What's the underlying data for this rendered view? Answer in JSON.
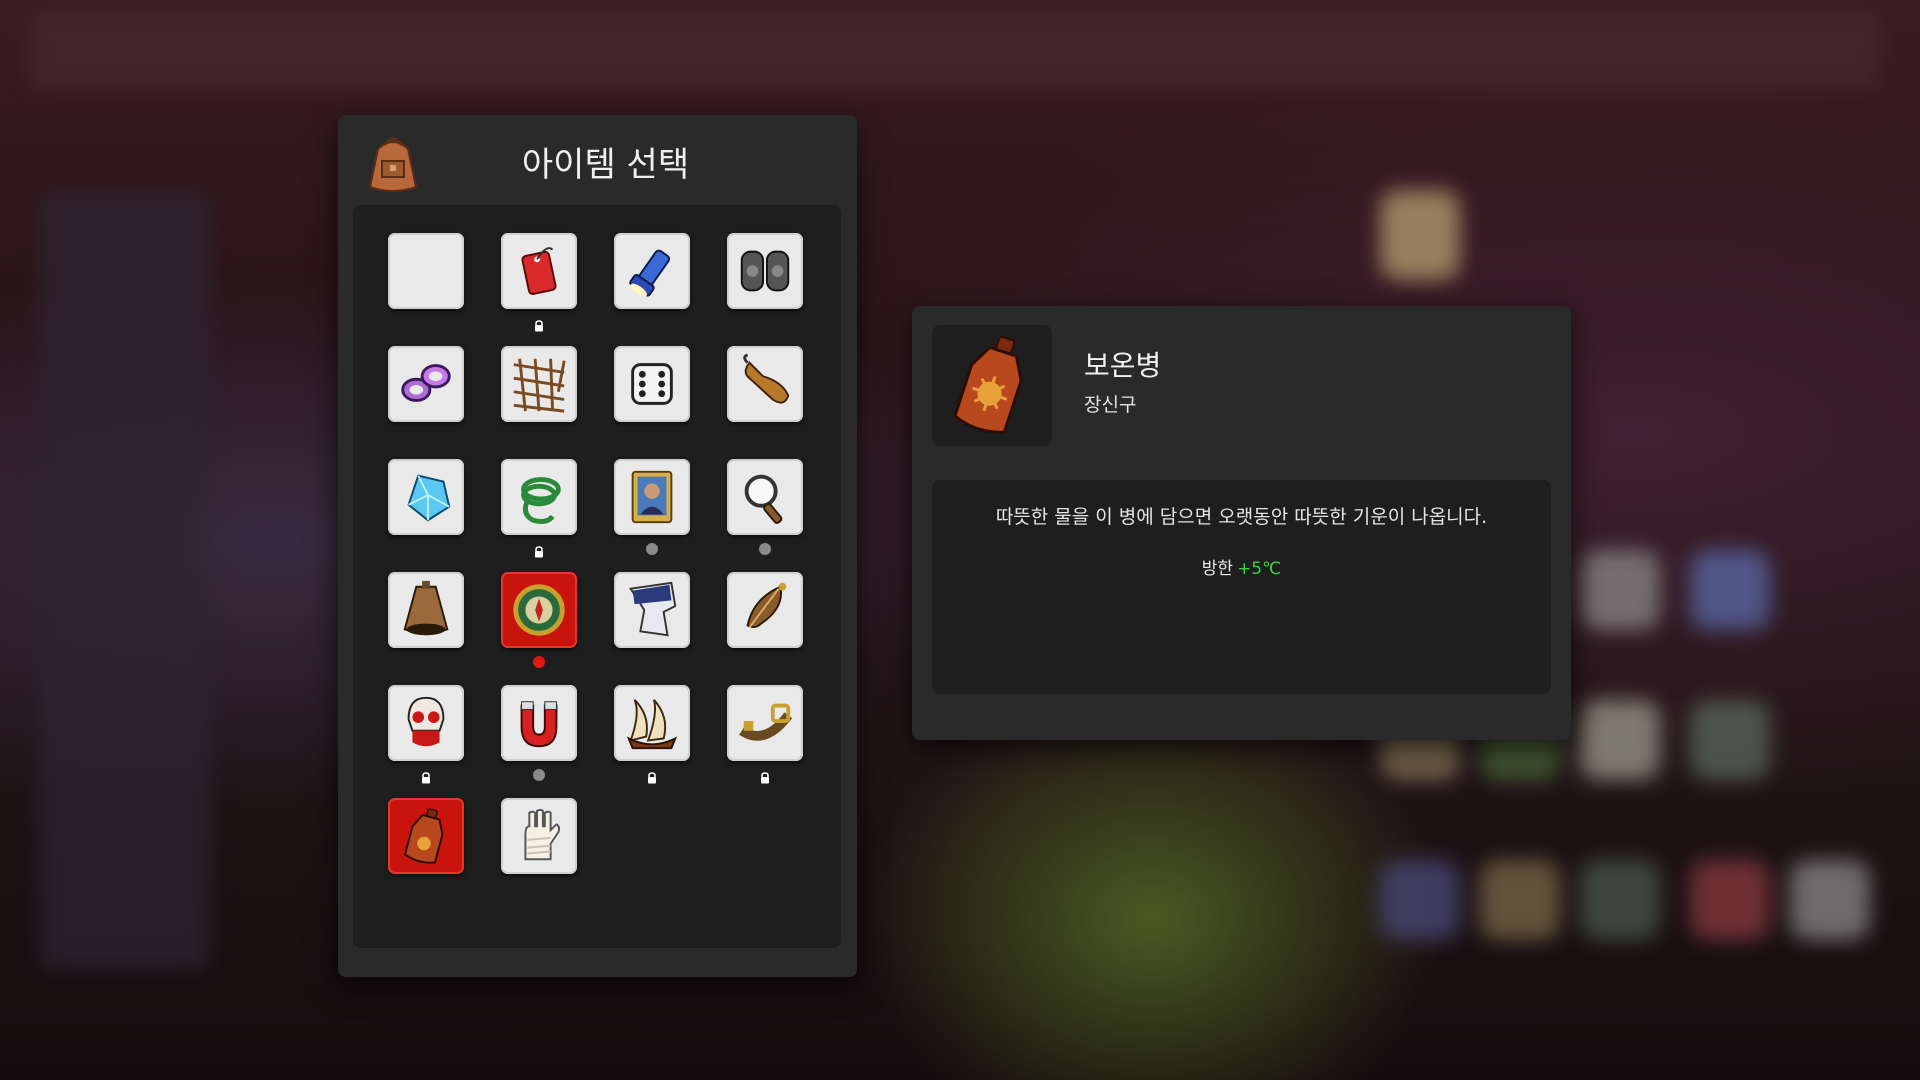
{
  "item_select": {
    "title": "아이템 선택",
    "icon": "backpack-icon",
    "items": [
      {
        "icon": "empty-slot",
        "selected": false,
        "mark": "none"
      },
      {
        "icon": "red-tag-icon",
        "selected": false,
        "mark": "lock"
      },
      {
        "icon": "flashlight-icon",
        "selected": false,
        "mark": "none"
      },
      {
        "icon": "knee-pads-icon",
        "selected": false,
        "mark": "none"
      },
      {
        "icon": "rings-icon",
        "selected": false,
        "mark": "none"
      },
      {
        "icon": "net-icon",
        "selected": false,
        "mark": "none"
      },
      {
        "icon": "dice-icon",
        "selected": false,
        "mark": "none"
      },
      {
        "icon": "hook-icon",
        "selected": false,
        "mark": "none"
      },
      {
        "icon": "crystal-icon",
        "selected": false,
        "mark": "none"
      },
      {
        "icon": "rope-icon",
        "selected": false,
        "mark": "lock"
      },
      {
        "icon": "portrait-card-icon",
        "selected": false,
        "mark": "dot"
      },
      {
        "icon": "magnifier-icon",
        "selected": false,
        "mark": "dot"
      },
      {
        "icon": "cowbell-icon",
        "selected": false,
        "mark": "none"
      },
      {
        "icon": "compass-icon",
        "selected": true,
        "mark": "dot-red"
      },
      {
        "icon": "torn-flyer-icon",
        "selected": false,
        "mark": "none"
      },
      {
        "icon": "feather-charm-icon",
        "selected": false,
        "mark": "none"
      },
      {
        "icon": "skull-icon",
        "selected": false,
        "mark": "lock"
      },
      {
        "icon": "magnet-icon",
        "selected": false,
        "mark": "dot"
      },
      {
        "icon": "claw-icon",
        "selected": false,
        "mark": "lock"
      },
      {
        "icon": "belt-icon",
        "selected": false,
        "mark": "lock"
      },
      {
        "icon": "hot-water-bottle-icon",
        "selected": true,
        "mark": "none"
      },
      {
        "icon": "bandaged-hand-icon",
        "selected": false,
        "mark": "none"
      }
    ]
  },
  "item_detail": {
    "icon": "hot-water-bottle-icon",
    "name": "보온병",
    "category": "장신구",
    "description": "따뜻한 물을 이 병에 담으면 오랫동안 따뜻한 기운이 나옵니다.",
    "stat_label": "방한",
    "stat_value": "+5℃",
    "stat_color": "#37d63a"
  },
  "colors": {
    "panel": "#2a2a2a",
    "inner_panel": "#1e1e1e",
    "selected_slot": "#c8140c",
    "slot": "#e9e9e9"
  }
}
